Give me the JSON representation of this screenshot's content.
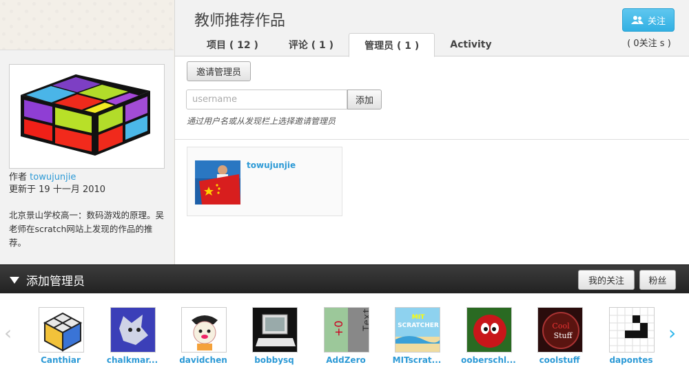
{
  "project": {
    "title": "教师推荐作品",
    "follow_label": "关注",
    "follow_count": "( 0关注 s )",
    "author_label": "作者",
    "author": "towujunjie",
    "updated_label": "更新于",
    "updated_date": "19 十一月 2010",
    "description": "北京景山学校高一：数码游戏的原理。吴老师在scratch网站上发现的作品的推荐。"
  },
  "tabs": [
    {
      "label": "项目 ( 12 )"
    },
    {
      "label": "评论 ( 1 )"
    },
    {
      "label": "管理员 ( 1 )",
      "active": true
    },
    {
      "label": "Activity"
    }
  ],
  "managers_panel": {
    "invite_label": "邀请管理员",
    "username_placeholder": "username",
    "add_label": "添加",
    "hint": "通过用户名或从发现栏上选择邀请管理员",
    "managers": [
      {
        "name": "towujunjie"
      }
    ]
  },
  "bottom_bar": {
    "title": "添加管理员",
    "following_label": "我的关注",
    "followers_label": "粉丝"
  },
  "carousel": {
    "users": [
      "Canthiar",
      "chalkmar...",
      "davidchen",
      "bobbysq",
      "AddZero",
      "MITscrat...",
      "ooberschl...",
      "coolstuff",
      "dapontes"
    ]
  },
  "colors": {
    "accent": "#2d9ad6",
    "button_blue": "#32b0e3",
    "bar": "#2b2b2b"
  },
  "icons": {
    "follow": "users-icon",
    "left": "chevron-left-icon",
    "right": "chevron-right-icon",
    "collapse": "triangle-down-icon"
  }
}
